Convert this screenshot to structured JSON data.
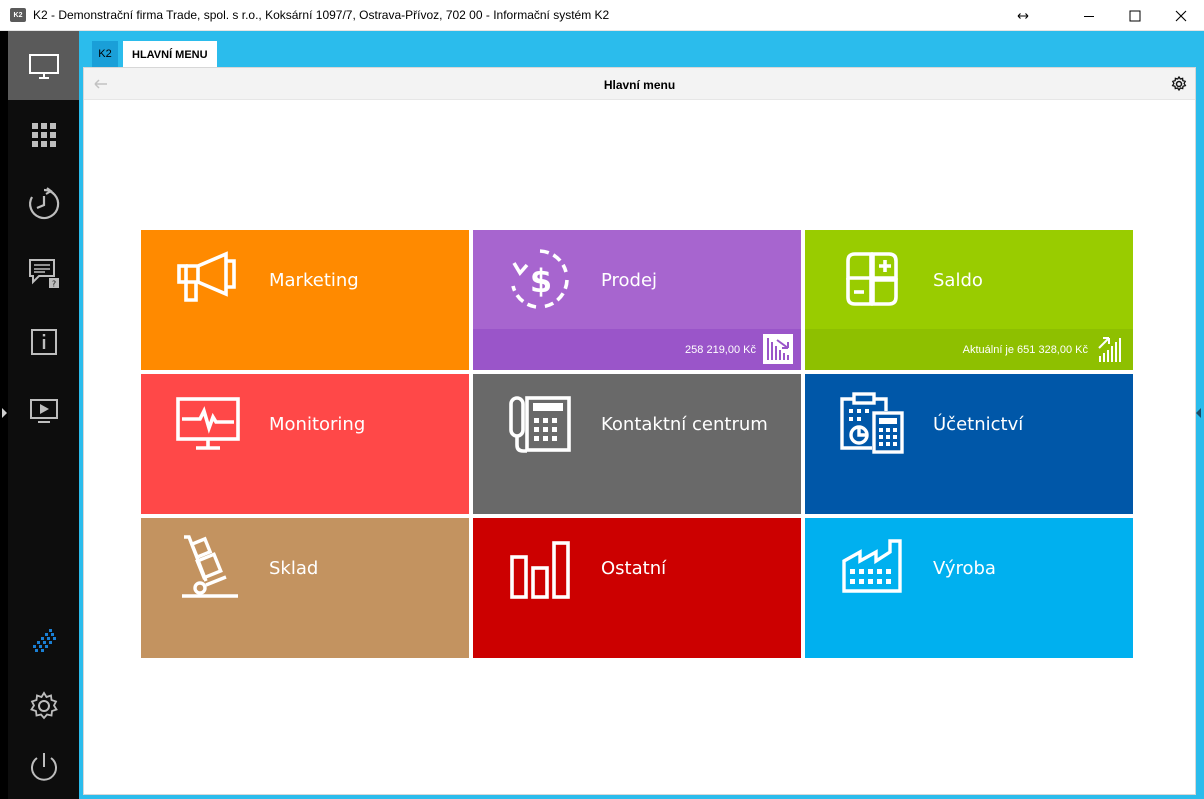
{
  "window": {
    "title": "K2 - Demonstrační firma Trade, spol. s r.o., Koksární 1097/7, Ostrava-Přívoz, 702 00 - Informační systém K2",
    "app_icon_text": "K2"
  },
  "rail": {
    "items": [
      {
        "name": "desktop-icon",
        "active": true
      },
      {
        "name": "apps-grid-icon",
        "active": false
      },
      {
        "name": "history-clock-icon",
        "active": false
      },
      {
        "name": "messages-icon",
        "active": false
      },
      {
        "name": "info-icon",
        "active": false
      },
      {
        "name": "presentation-icon",
        "active": false
      },
      {
        "name": "k2-logo-icon",
        "active": false
      },
      {
        "name": "gear-icon",
        "active": false
      },
      {
        "name": "power-icon",
        "active": false
      }
    ]
  },
  "tabs": {
    "k2_label": "K2",
    "main_label": "HLAVNÍ MENU"
  },
  "panel": {
    "title": "Hlavní menu"
  },
  "tiles": [
    {
      "label": "Marketing",
      "icon": "megaphone-icon",
      "color": "#ff8a00"
    },
    {
      "label": "Prodej",
      "icon": "dollar-cycle-icon",
      "color": "#a765cf",
      "footer_color": "#9a55c9",
      "footer_text": "258 219,00 Kč",
      "footer_icon": "chart-down-icon"
    },
    {
      "label": "Saldo",
      "icon": "balance-icon",
      "color": "#99cc00",
      "footer_color": "#8ec000",
      "footer_text": "Aktuální je 651 328,00 Kč",
      "footer_icon": "chart-up-icon"
    },
    {
      "label": "Monitoring",
      "icon": "monitor-pulse-icon",
      "color": "#ff4848"
    },
    {
      "label": "Kontaktní centrum",
      "icon": "phone-icon",
      "color": "#696969"
    },
    {
      "label": "Účetnictví",
      "icon": "accounting-icon",
      "color": "#0057a8"
    },
    {
      "label": "Sklad",
      "icon": "hand-truck-icon",
      "color": "#c39360"
    },
    {
      "label": "Ostatní",
      "icon": "bars-icon",
      "color": "#cc0000"
    },
    {
      "label": "Výroba",
      "icon": "factory-icon",
      "color": "#00b0ef"
    }
  ]
}
